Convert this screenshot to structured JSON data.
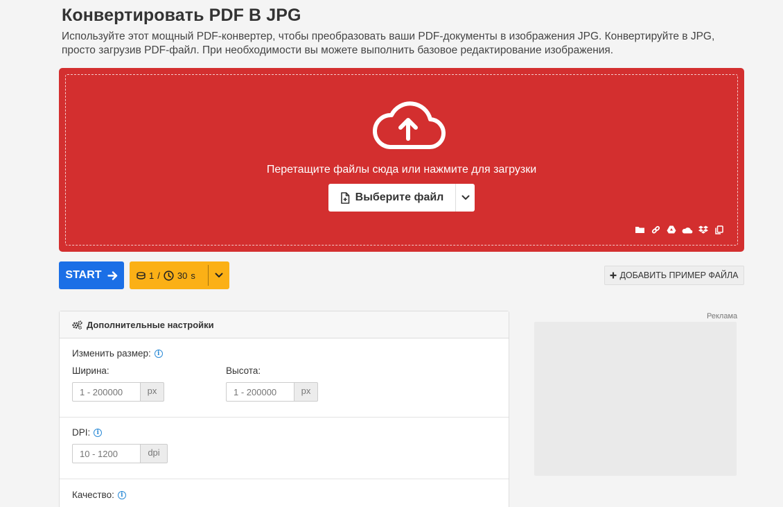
{
  "header": {
    "title": "Конвертировать PDF В JPG",
    "description": "Используйте этот мощный PDF-конвертер, чтобы преобразовать ваши PDF-документы в изображения JPG. Конвертируйте в JPG, просто загрузив PDF-файл. При необходимости вы можете выполнить базовое редактирование изображения."
  },
  "dropzone": {
    "hint": "Перетащите файлы сюда или нажмите для загрузки",
    "choose_label": "Выберите файл",
    "sources": [
      "folder-icon",
      "link-icon",
      "google-drive-icon",
      "onedrive-icon",
      "dropbox-icon",
      "clipboard-icon"
    ]
  },
  "actions": {
    "start_label": "START",
    "credits_count": "1",
    "credits_divider": "/",
    "time_value": "30",
    "time_unit": "s",
    "sample_label": "ДОБАВИТЬ ПРИМЕР ФАЙЛА"
  },
  "settings": {
    "heading": "Дополнительные настройки",
    "resize": {
      "label": "Изменить размер:",
      "width_label": "Ширина:",
      "width_placeholder": "1 - 200000",
      "width_unit": "px",
      "height_label": "Высота:",
      "height_placeholder": "1 - 200000",
      "height_unit": "px"
    },
    "dpi": {
      "label": "DPI:",
      "placeholder": "10 - 1200",
      "unit": "dpi"
    },
    "quality": {
      "label": "Качество:"
    }
  },
  "ad": {
    "label": "Реклама"
  },
  "colors": {
    "dropzone": "#d32f2f",
    "start": "#1b6fe6",
    "credits": "#fbb016",
    "info": "#2b8ad6"
  }
}
